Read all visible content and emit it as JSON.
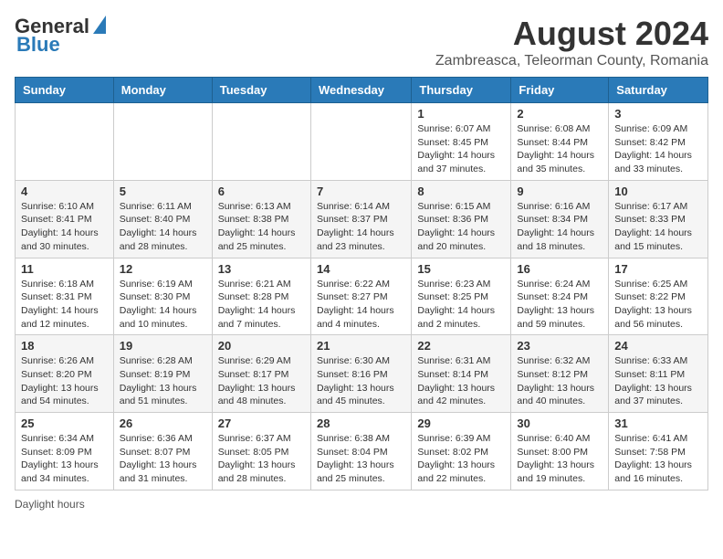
{
  "header": {
    "logo_general": "General",
    "logo_blue": "Blue",
    "month_title": "August 2024",
    "subtitle": "Zambreasca, Teleorman County, Romania"
  },
  "days_of_week": [
    "Sunday",
    "Monday",
    "Tuesday",
    "Wednesday",
    "Thursday",
    "Friday",
    "Saturday"
  ],
  "weeks": [
    [
      {
        "day": "",
        "info": ""
      },
      {
        "day": "",
        "info": ""
      },
      {
        "day": "",
        "info": ""
      },
      {
        "day": "",
        "info": ""
      },
      {
        "day": "1",
        "info": "Sunrise: 6:07 AM\nSunset: 8:45 PM\nDaylight: 14 hours\nand 37 minutes."
      },
      {
        "day": "2",
        "info": "Sunrise: 6:08 AM\nSunset: 8:44 PM\nDaylight: 14 hours\nand 35 minutes."
      },
      {
        "day": "3",
        "info": "Sunrise: 6:09 AM\nSunset: 8:42 PM\nDaylight: 14 hours\nand 33 minutes."
      }
    ],
    [
      {
        "day": "4",
        "info": "Sunrise: 6:10 AM\nSunset: 8:41 PM\nDaylight: 14 hours\nand 30 minutes."
      },
      {
        "day": "5",
        "info": "Sunrise: 6:11 AM\nSunset: 8:40 PM\nDaylight: 14 hours\nand 28 minutes."
      },
      {
        "day": "6",
        "info": "Sunrise: 6:13 AM\nSunset: 8:38 PM\nDaylight: 14 hours\nand 25 minutes."
      },
      {
        "day": "7",
        "info": "Sunrise: 6:14 AM\nSunset: 8:37 PM\nDaylight: 14 hours\nand 23 minutes."
      },
      {
        "day": "8",
        "info": "Sunrise: 6:15 AM\nSunset: 8:36 PM\nDaylight: 14 hours\nand 20 minutes."
      },
      {
        "day": "9",
        "info": "Sunrise: 6:16 AM\nSunset: 8:34 PM\nDaylight: 14 hours\nand 18 minutes."
      },
      {
        "day": "10",
        "info": "Sunrise: 6:17 AM\nSunset: 8:33 PM\nDaylight: 14 hours\nand 15 minutes."
      }
    ],
    [
      {
        "day": "11",
        "info": "Sunrise: 6:18 AM\nSunset: 8:31 PM\nDaylight: 14 hours\nand 12 minutes."
      },
      {
        "day": "12",
        "info": "Sunrise: 6:19 AM\nSunset: 8:30 PM\nDaylight: 14 hours\nand 10 minutes."
      },
      {
        "day": "13",
        "info": "Sunrise: 6:21 AM\nSunset: 8:28 PM\nDaylight: 14 hours\nand 7 minutes."
      },
      {
        "day": "14",
        "info": "Sunrise: 6:22 AM\nSunset: 8:27 PM\nDaylight: 14 hours\nand 4 minutes."
      },
      {
        "day": "15",
        "info": "Sunrise: 6:23 AM\nSunset: 8:25 PM\nDaylight: 14 hours\nand 2 minutes."
      },
      {
        "day": "16",
        "info": "Sunrise: 6:24 AM\nSunset: 8:24 PM\nDaylight: 13 hours\nand 59 minutes."
      },
      {
        "day": "17",
        "info": "Sunrise: 6:25 AM\nSunset: 8:22 PM\nDaylight: 13 hours\nand 56 minutes."
      }
    ],
    [
      {
        "day": "18",
        "info": "Sunrise: 6:26 AM\nSunset: 8:20 PM\nDaylight: 13 hours\nand 54 minutes."
      },
      {
        "day": "19",
        "info": "Sunrise: 6:28 AM\nSunset: 8:19 PM\nDaylight: 13 hours\nand 51 minutes."
      },
      {
        "day": "20",
        "info": "Sunrise: 6:29 AM\nSunset: 8:17 PM\nDaylight: 13 hours\nand 48 minutes."
      },
      {
        "day": "21",
        "info": "Sunrise: 6:30 AM\nSunset: 8:16 PM\nDaylight: 13 hours\nand 45 minutes."
      },
      {
        "day": "22",
        "info": "Sunrise: 6:31 AM\nSunset: 8:14 PM\nDaylight: 13 hours\nand 42 minutes."
      },
      {
        "day": "23",
        "info": "Sunrise: 6:32 AM\nSunset: 8:12 PM\nDaylight: 13 hours\nand 40 minutes."
      },
      {
        "day": "24",
        "info": "Sunrise: 6:33 AM\nSunset: 8:11 PM\nDaylight: 13 hours\nand 37 minutes."
      }
    ],
    [
      {
        "day": "25",
        "info": "Sunrise: 6:34 AM\nSunset: 8:09 PM\nDaylight: 13 hours\nand 34 minutes."
      },
      {
        "day": "26",
        "info": "Sunrise: 6:36 AM\nSunset: 8:07 PM\nDaylight: 13 hours\nand 31 minutes."
      },
      {
        "day": "27",
        "info": "Sunrise: 6:37 AM\nSunset: 8:05 PM\nDaylight: 13 hours\nand 28 minutes."
      },
      {
        "day": "28",
        "info": "Sunrise: 6:38 AM\nSunset: 8:04 PM\nDaylight: 13 hours\nand 25 minutes."
      },
      {
        "day": "29",
        "info": "Sunrise: 6:39 AM\nSunset: 8:02 PM\nDaylight: 13 hours\nand 22 minutes."
      },
      {
        "day": "30",
        "info": "Sunrise: 6:40 AM\nSunset: 8:00 PM\nDaylight: 13 hours\nand 19 minutes."
      },
      {
        "day": "31",
        "info": "Sunrise: 6:41 AM\nSunset: 7:58 PM\nDaylight: 13 hours\nand 16 minutes."
      }
    ]
  ],
  "footer": {
    "note": "Daylight hours"
  }
}
